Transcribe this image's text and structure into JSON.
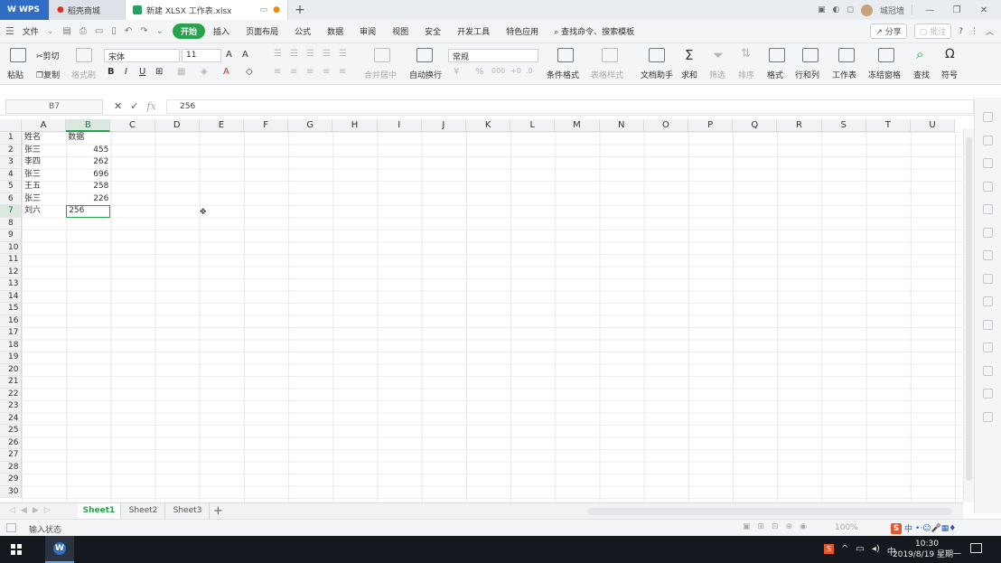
{
  "titlebar": {
    "wps_tab": "WPS",
    "store_tab": "稻壳商城",
    "doc_tab": "新建 XLSX 工作表.xlsx",
    "new_tab": "+",
    "user": "城冠墙"
  },
  "menu": {
    "file": "文件",
    "items": [
      "开始",
      "插入",
      "页面布局",
      "公式",
      "数据",
      "审阅",
      "视图",
      "安全",
      "开发工具",
      "特色应用"
    ],
    "search": "查找命令、搜索模板",
    "share": "分享",
    "comment": "批注"
  },
  "ribbon": {
    "paste": "粘贴",
    "cut": "剪切",
    "copy": "复制",
    "format_painter": "格式刷",
    "font": "宋体",
    "font_size": "11",
    "merge": "合并居中",
    "wrap": "自动换行",
    "number_format": "常规",
    "conditional": "条件格式",
    "table_style": "表格样式",
    "doc_helper": "文档助手",
    "sum": "求和",
    "filter": "筛选",
    "sort": "排序",
    "format": "格式",
    "row_col": "行和列",
    "worksheet": "工作表",
    "freeze": "冻结窗格",
    "find": "查找",
    "symbol": "符号"
  },
  "formula": {
    "cell_ref": "B7",
    "value": "256"
  },
  "grid": {
    "columns": [
      "A",
      "B",
      "C",
      "D",
      "E",
      "F",
      "G",
      "H",
      "I",
      "J",
      "K",
      "L",
      "M",
      "N",
      "O",
      "P",
      "Q",
      "R",
      "S",
      "T",
      "U"
    ],
    "selected_column": "B",
    "rows": [
      "1",
      "2",
      "3",
      "4",
      "5",
      "6",
      "7",
      "8",
      "9",
      "10",
      "11",
      "12",
      "13",
      "14",
      "15",
      "16",
      "17",
      "18",
      "19",
      "20",
      "21",
      "22",
      "23",
      "24",
      "25",
      "26",
      "27",
      "28",
      "29",
      "30"
    ],
    "selected_row": "7",
    "data": [
      {
        "a": "姓名",
        "b": "数据"
      },
      {
        "a": "张三",
        "b": "455"
      },
      {
        "a": "李四",
        "b": "262"
      },
      {
        "a": "张三",
        "b": "696"
      },
      {
        "a": "王五",
        "b": "258"
      },
      {
        "a": "张三",
        "b": "226"
      },
      {
        "a": "刘六",
        "b": "256"
      }
    ]
  },
  "sheets": [
    "Sheet1",
    "Sheet2",
    "Sheet3"
  ],
  "status": {
    "mode": "输入状态",
    "zoom": "100%"
  },
  "taskbar": {
    "time": "10:30",
    "date": "2019/8/19 星期一",
    "ime": "中"
  }
}
